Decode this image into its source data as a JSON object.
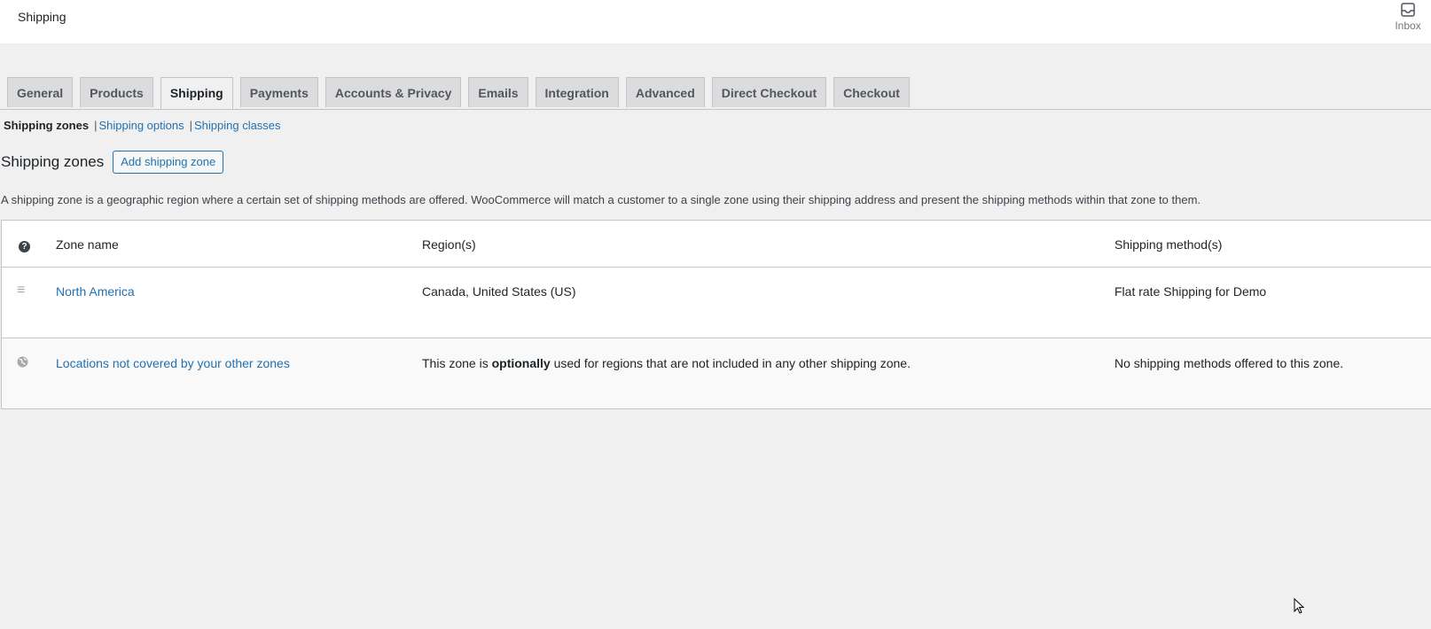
{
  "header": {
    "title": "Shipping",
    "inbox_label": "Inbox"
  },
  "tabs": [
    {
      "label": "General",
      "active": false
    },
    {
      "label": "Products",
      "active": false
    },
    {
      "label": "Shipping",
      "active": true
    },
    {
      "label": "Payments",
      "active": false
    },
    {
      "label": "Accounts & Privacy",
      "active": false
    },
    {
      "label": "Emails",
      "active": false
    },
    {
      "label": "Integration",
      "active": false
    },
    {
      "label": "Advanced",
      "active": false
    },
    {
      "label": "Direct Checkout",
      "active": false
    },
    {
      "label": "Checkout",
      "active": false
    }
  ],
  "sections": {
    "current": "Shipping zones",
    "separator": "|",
    "links": [
      "Shipping options",
      "Shipping classes"
    ]
  },
  "page": {
    "heading": "Shipping zones",
    "add_button": "Add shipping zone",
    "description": "A shipping zone is a geographic region where a certain set of shipping methods are offered. WooCommerce will match a customer to a single zone using their shipping address and present the shipping methods within that zone to them."
  },
  "table": {
    "columns": {
      "help_icon": "help-icon",
      "zone_name": "Zone name",
      "regions": "Region(s)",
      "methods": "Shipping method(s)"
    },
    "zones": [
      {
        "icon": "drag-handle-icon",
        "name": "North America",
        "regions": "Canada, United States (US)",
        "methods": "Flat rate Shipping for Demo"
      }
    ],
    "rest_of_world": {
      "icon": "globe-icon",
      "name": "Locations not covered by your other zones",
      "region_prefix": "This zone is ",
      "region_emphasis": "optionally",
      "region_suffix": " used for regions that are not included in any other shipping zone.",
      "methods": "No shipping methods offered to this zone."
    }
  }
}
